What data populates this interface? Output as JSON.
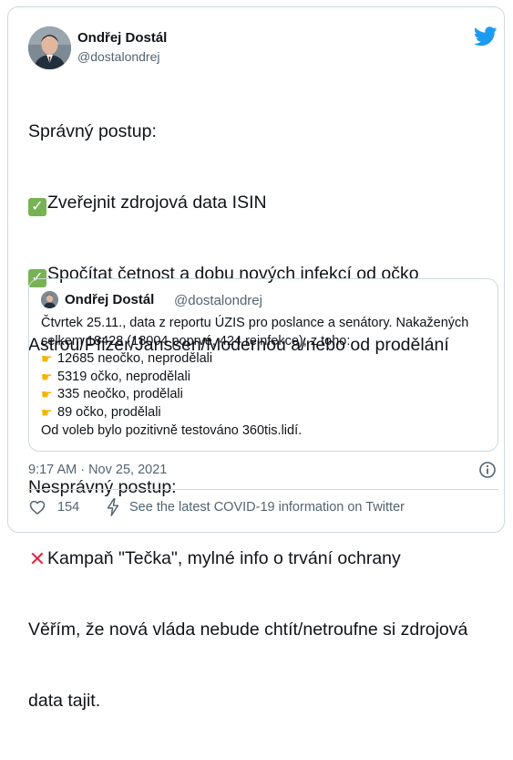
{
  "tweet": {
    "author_name": "Ondřej Dostál",
    "author_handle": "@dostalondrej",
    "lines": [
      {
        "emoji": "",
        "text": "Správný postup:"
      },
      {
        "emoji": "check",
        "text": "Zveřejnit zdrojová data ISIN"
      },
      {
        "emoji": "check",
        "text": "Spočítat četnost a dobu nových infekcí od očko"
      },
      {
        "emoji": "",
        "text": "Astrou/Pfizer/Janssen/Modernou a/nebo od prodělání"
      },
      {
        "emoji": "",
        "text": ""
      },
      {
        "emoji": "",
        "text": "Nesprávný postup:"
      },
      {
        "emoji": "cross",
        "text": "Kampaň \"Tečka\", mylné info o trvání ochrany"
      },
      {
        "emoji": "",
        "text": "Věřím, že nová vláda nebude chtít/netroufne si zdrojová"
      },
      {
        "emoji": "",
        "text": "data tajit."
      }
    ],
    "timestamp": "9:17 AM · Nov 25, 2021",
    "like_count": "154",
    "covid_link": "See the latest COVID-19 information on Twitter"
  },
  "quote": {
    "author_name": "Ondřej Dostál",
    "author_handle": "@dostalondrej",
    "lines": [
      {
        "emoji": "",
        "text": "Čtvrtek 25.11., data z reportu ÚZIS pro poslance a senátory. Nakažených"
      },
      {
        "emoji": "",
        "text": "celkem 18428 (18004 poprvé, 424 reinfekce), z toho:"
      },
      {
        "emoji": "point",
        "text": "12685 neočko, neprodělali"
      },
      {
        "emoji": "point",
        "text": "5319 očko, neprodělali"
      },
      {
        "emoji": "point",
        "text": "335 neočko, prodělali"
      },
      {
        "emoji": "point",
        "text": "89 očko, prodělali"
      },
      {
        "emoji": "",
        "text": "Od voleb bylo pozitivně testováno 360tis.lidí."
      }
    ]
  },
  "colors": {
    "twitter_blue": "#1d9bf0",
    "check_green": "#77b255",
    "cross_red": "#dd2e44",
    "point_yellow": "#f4b400",
    "muted_text": "#536471"
  },
  "icons": {
    "brand": "twitter-bird-icon",
    "info": "info-icon",
    "like": "heart-icon",
    "covid": "bolt-icon"
  }
}
